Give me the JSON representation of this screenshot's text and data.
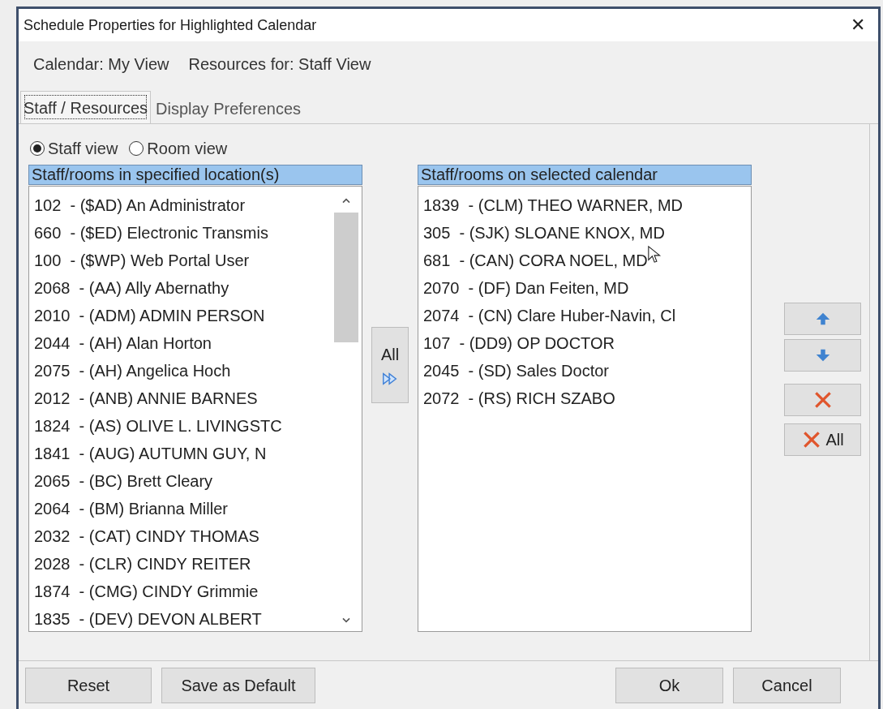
{
  "window": {
    "title": "Schedule Properties for Highlighted Calendar",
    "close": "✕"
  },
  "info": [
    "Calendar: My View",
    "Resources for: Staff View"
  ],
  "tabs": [
    {
      "label": "Staff / Resources",
      "selected": true
    },
    {
      "label": "Display Preferences",
      "selected": false
    }
  ],
  "view_options": [
    {
      "label": "Staff view",
      "selected": true
    },
    {
      "label": "Room view",
      "selected": false
    }
  ],
  "available": {
    "header": "Staff/rooms in specified location(s)",
    "items": [
      "102  - ($AD) An Administrator",
      "660  - ($ED) Electronic Transmis",
      "100  - ($WP) Web Portal User",
      "2068  - (AA) Ally Abernathy",
      "2010  - (ADM) ADMIN PERSON",
      "2044  - (AH) Alan Horton",
      "2075  - (AH) Angelica Hoch",
      "2012  - (ANB) ANNIE BARNES",
      "1824  - (AS) OLIVE L. LIVINGSTC",
      "1841  - (AUG) AUTUMN GUY, N",
      "2065  - (BC) Brett Cleary",
      "2064  - (BM) Brianna Miller",
      "2032  - (CAT) CINDY THOMAS",
      "2028  - (CLR) CINDY REITER",
      "1874  - (CMG) CINDY Grimmie",
      "1835  - (DEV) DEVON ALBERT"
    ]
  },
  "add_all_button": "All",
  "selected": {
    "header": "Staff/rooms on selected calendar",
    "items": [
      "1839  - (CLM) THEO WARNER, MD",
      "305  - (SJK) SLOANE KNOX, MD",
      "681  - (CAN) CORA NOEL, MD",
      "2070  - (DF) Dan Feiten, MD",
      "2074  - (CN) Clare Huber-Navin, Cl",
      "107  - (DD9) OP DOCTOR",
      "2045  - (SD) Sales Doctor",
      "2072  - (RS) RICH SZABO"
    ]
  },
  "side_buttons": [
    {
      "kind": "up"
    },
    {
      "kind": "down"
    },
    {
      "kind": "remove"
    },
    {
      "kind": "remove_all",
      "label": "All"
    }
  ],
  "footer_buttons": [
    "Reset",
    "Save as Default",
    "Ok",
    "Cancel"
  ]
}
